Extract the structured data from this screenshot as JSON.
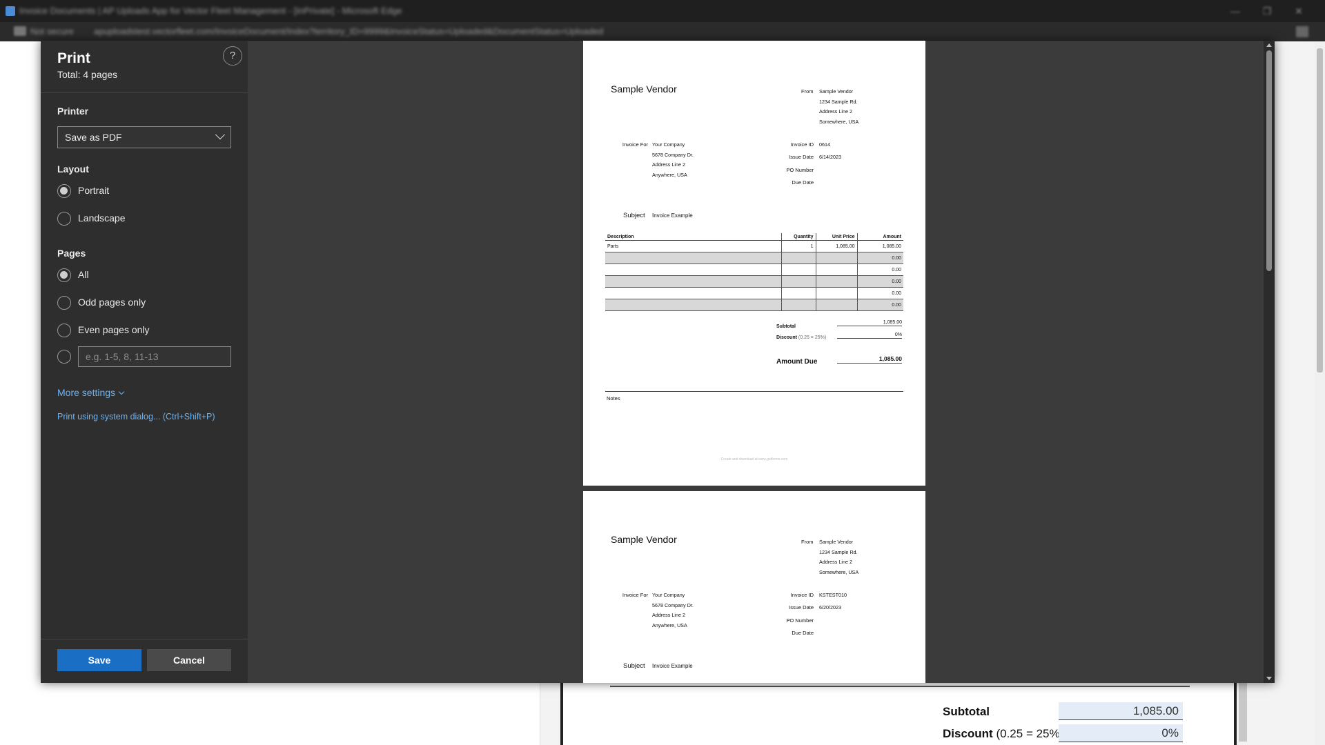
{
  "browser": {
    "title": "Invoice Documents | AP Uploads App for Vector Fleet Management - [InPrivate] - Microsoft Edge",
    "not_secure": "Not secure",
    "url": "apuploadstest.vectorfleet.com/InvoiceDocument/Index?territory_ID=9999&InvoiceStatus=Uploaded&DocumentStatus=Uploaded"
  },
  "dialog": {
    "title": "Print",
    "total": "Total: 4 pages",
    "help": "?",
    "printer_label": "Printer",
    "printer_value": "Save as PDF",
    "layout_label": "Layout",
    "layout_options": [
      "Portrait",
      "Landscape"
    ],
    "pages_label": "Pages",
    "pages_options": [
      "All",
      "Odd pages only",
      "Even pages only"
    ],
    "range_placeholder": "e.g. 1-5, 8, 11-13",
    "more_settings": "More settings",
    "system_dialog": "Print using system dialog... (Ctrl+Shift+P)",
    "save": "Save",
    "cancel": "Cancel"
  },
  "pages": [
    {
      "vendor": "Sample Vendor",
      "from_label": "From",
      "from_lines": [
        "Sample Vendor",
        "1234 Sample Rd.",
        "Address Line 2",
        "Somewhere, USA"
      ],
      "invoice_for_label": "Invoice For",
      "invoice_for_lines": [
        "Your Company",
        "5678 Company Dr.",
        "Address Line 2",
        "Anywhere, USA"
      ],
      "invoice_id_label": "Invoice ID",
      "invoice_id": "0614",
      "issue_date_label": "Issue Date",
      "issue_date": "6/14/2023",
      "po_label": "PO Number",
      "due_date_label": "Due Date",
      "subject_label": "Subject",
      "subject": "Invoice Example",
      "table_headers": [
        "Description",
        "Quantity",
        "Unit Price",
        "Amount"
      ],
      "rows": [
        [
          "Parts",
          "1",
          "1,085.00",
          "1,085.00"
        ],
        [
          "",
          "",
          "",
          "0.00"
        ],
        [
          "",
          "",
          "",
          "0.00"
        ],
        [
          "",
          "",
          "",
          "0.00"
        ],
        [
          "",
          "",
          "",
          "0.00"
        ],
        [
          "",
          "",
          "",
          "0.00"
        ]
      ],
      "subtotal_label": "Subtotal",
      "subtotal": "1,085.00",
      "discount_label": "Discount",
      "discount_hint": "(0.25 = 25%)",
      "discount": "0%",
      "amount_due_label": "Amount Due",
      "amount_due": "1,085.00",
      "notes_label": "Notes",
      "footer": "Create and download at www.getforms.com"
    },
    {
      "vendor": "Sample Vendor",
      "from_label": "From",
      "from_lines": [
        "Sample Vendor",
        "1234 Sample Rd.",
        "Address Line 2",
        "Somewhere, USA"
      ],
      "invoice_for_label": "Invoice For",
      "invoice_for_lines": [
        "Your Company",
        "5678 Company Dr.",
        "Address Line 2",
        "Anywhere, USA"
      ],
      "invoice_id_label": "Invoice ID",
      "invoice_id": "KSTEST010",
      "issue_date_label": "Issue Date",
      "issue_date": "6/20/2023",
      "po_label": "PO Number",
      "due_date_label": "Due Date",
      "subject_label": "Subject",
      "subject": "Invoice Example"
    }
  ],
  "background": {
    "subtotal_label": "Subtotal",
    "subtotal": "1,085.00",
    "discount_label": "Discount",
    "discount_hint": "(0.25 = 25%)",
    "discount": "0%"
  },
  "colors": {
    "accent": "#1a6fc4",
    "link": "#6db3f2",
    "sidebar": "#2e2e2e",
    "preview_bg": "#3b3b3b"
  }
}
